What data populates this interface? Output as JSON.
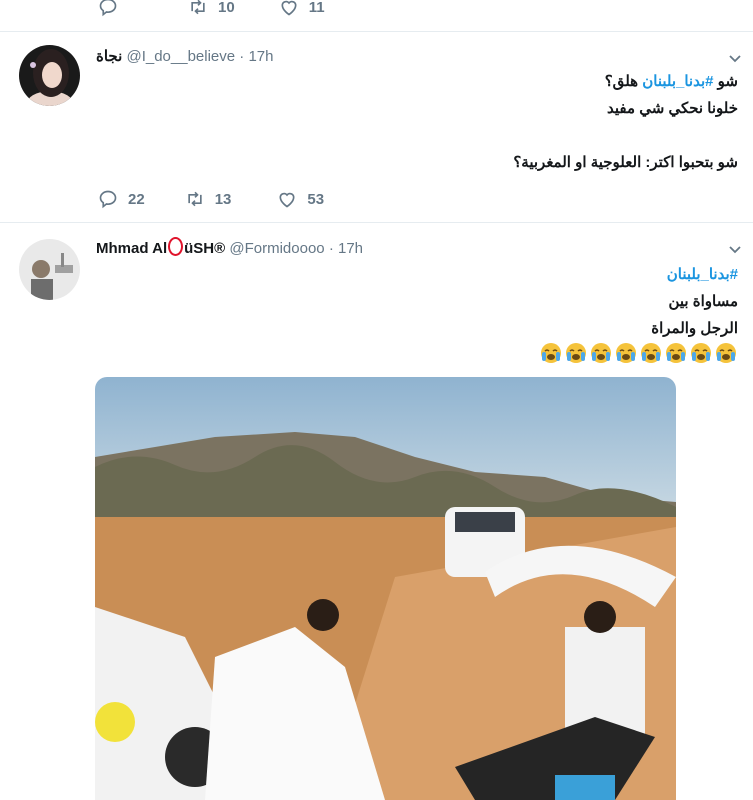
{
  "prev_tweet": {
    "retweets": "10",
    "likes": "11"
  },
  "tweet1": {
    "name": "نجاة",
    "handle": "@I_do__believe",
    "time": "17h",
    "line1_prefix": "شو ",
    "hashtag": "#بدنا_بلبنان",
    "line1_suffix": " هلق؟",
    "line2": "خلونا نحكي شي مفيد",
    "line3": "شو بتحبوا اكتر: العلوجية او المغربية؟",
    "replies": "22",
    "retweets": "13",
    "likes": "53"
  },
  "tweet2": {
    "name_prefix": "Mhmad Al",
    "name_suffix": "üSH®",
    "handle": "@Formidoooo",
    "time": "17h",
    "hashtag": "#بدنا_بلبنان",
    "line1": "مساواة بين",
    "line2": "الرجل والمراة",
    "emoji_count": 8,
    "emoji_name": "loudly-crying-face"
  },
  "colors": {
    "accent": "#1b95e0",
    "muted": "#657786",
    "border": "#e6ecf0"
  }
}
